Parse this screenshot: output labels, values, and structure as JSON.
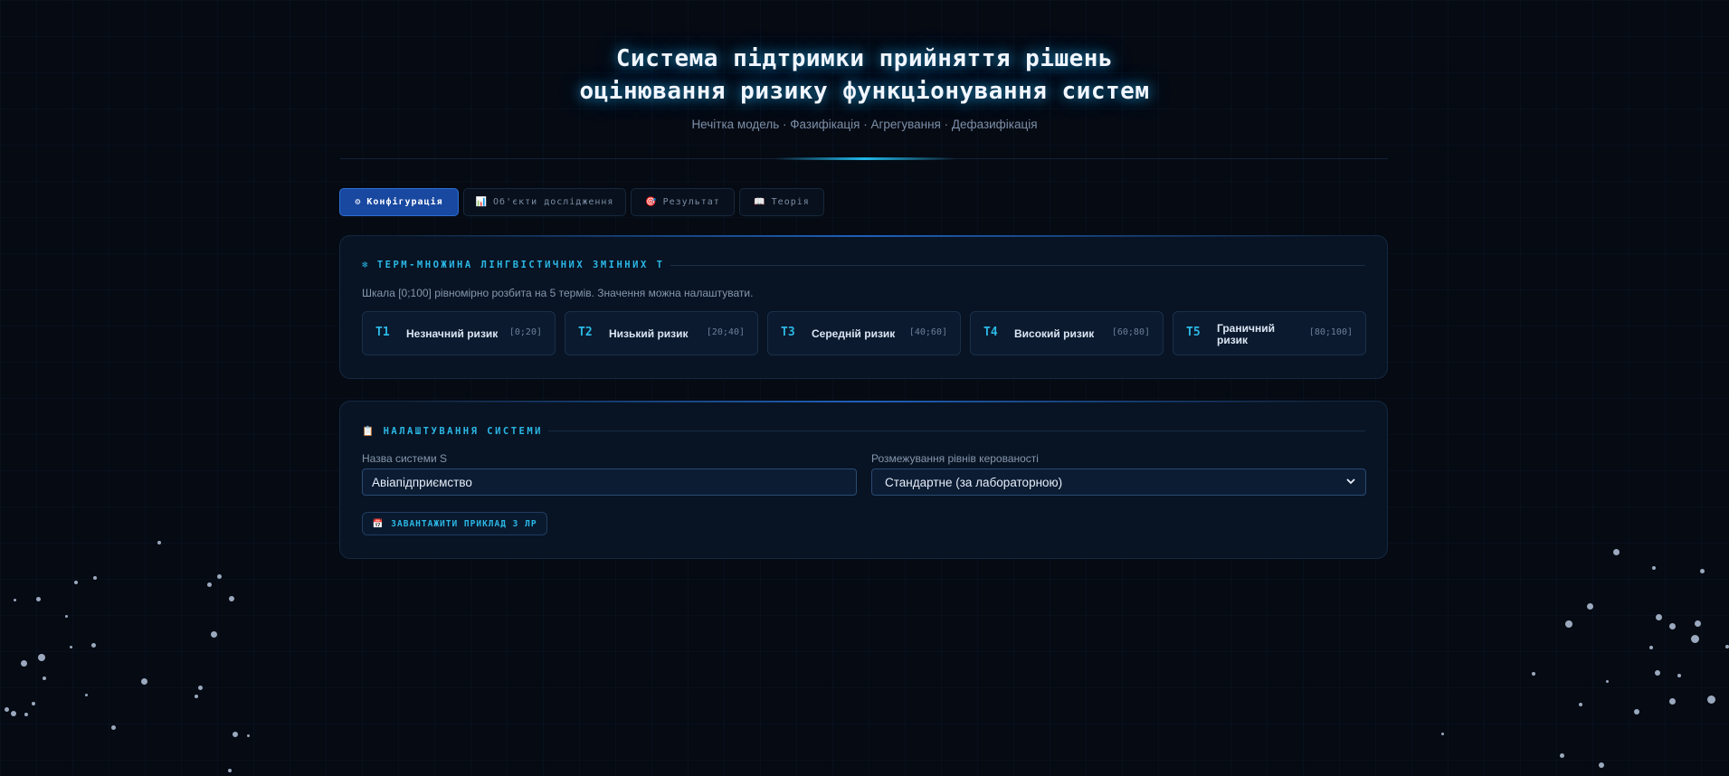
{
  "header": {
    "title_line1": "Система підтримки прийняття рішень",
    "title_line2": "оцінювання ризику функціонування систем",
    "subtitle": "Нечітка модель · Фазифікація · Агрегування · Дефазифікація"
  },
  "tabs": [
    {
      "icon": "⚙",
      "label": "Конфігурація",
      "active": true
    },
    {
      "icon": "📊",
      "label": "Об'єкти дослідження",
      "active": false
    },
    {
      "icon": "🎯",
      "label": "Результат",
      "active": false
    },
    {
      "icon": "📖",
      "label": "Теорія",
      "active": false
    }
  ],
  "terms_panel": {
    "icon": "❄",
    "title": "ТЕРМ-МНОЖИНА ЛІНГВІСТИЧНИХ ЗМІННИХ T",
    "description": "Шкала [0;100] рівномірно розбита на 5 термів. Значення можна налаштувати.",
    "terms": [
      {
        "code": "T1",
        "name": "Незначний ризик",
        "range": "[0;20]"
      },
      {
        "code": "T2",
        "name": "Низький ризик",
        "range": "[20;40]"
      },
      {
        "code": "T3",
        "name": "Середній ризик",
        "range": "[40;60]"
      },
      {
        "code": "T4",
        "name": "Високий ризик",
        "range": "[60;80]"
      },
      {
        "code": "T5",
        "name": "Граничний ризик",
        "range": "[80;100]"
      }
    ]
  },
  "settings_panel": {
    "icon": "📋",
    "title": "НАЛАШТУВАННЯ СИСТЕМИ",
    "system_name_label": "Назва системи S",
    "system_name_value": "Авіапідприємство",
    "levels_label": "Розмежування рівнів керованості",
    "levels_value": "Стандартне (за лабораторною)",
    "load_icon": "📅",
    "load_button": "ЗАВАНТАЖИТИ ПРИКЛАД З ЛР"
  },
  "colors": {
    "background": "#050a13",
    "accent": "#2bb8e6",
    "active_tab": "#1848a0",
    "panel": "#081424"
  }
}
